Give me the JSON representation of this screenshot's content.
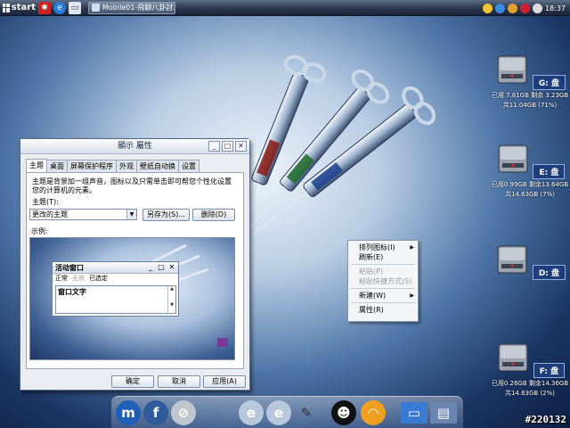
{
  "taskbar": {
    "start_label": "start",
    "task_button": "Mobile01-飛聊八卦討...",
    "clock": "18:37"
  },
  "dialog": {
    "title": "顯示 屬性",
    "tabs": [
      "主題",
      "桌面",
      "屏幕保护程序",
      "外观",
      "壁纸自动换",
      "设置"
    ],
    "description": "主题是背景加一组声音，图标以及只需单击即可帮您个性化设置您的计算机的元素。",
    "theme_label": "主题(T):",
    "theme_value": "更改的主题",
    "save_as_button": "另存为(S)...",
    "delete_button": "删除(D)",
    "sample_label": "示例:",
    "preview": {
      "window_title": "活动窗口",
      "menu_normal": "正常",
      "menu_disabled": "无效",
      "menu_selected": "已选定",
      "window_text": "窗口文字"
    },
    "ok_button": "确定",
    "cancel_button": "取消",
    "apply_button": "应用(A)"
  },
  "context_menu": {
    "groups": [
      [
        {
          "label": "排列图标(I)",
          "submenu": true
        },
        {
          "label": "刷新(E)",
          "submenu": false
        }
      ],
      [
        {
          "label": "粘贴(P)",
          "disabled": true
        },
        {
          "label": "粘贴快捷方式(S)",
          "disabled": true
        }
      ],
      [
        {
          "label": "新建(W)",
          "submenu": true
        }
      ],
      [
        {
          "label": "属性(R)",
          "submenu": false
        }
      ]
    ]
  },
  "drives": [
    {
      "letter": "G: 盘",
      "info1": "已用 7.81GB 剩余 3.23GB",
      "info2": "共11.04GB (71%)"
    },
    {
      "letter": "E: 盘",
      "info1": "已用0.99GB 剩余13.64GB",
      "info2": "共14.63GB (7%)"
    },
    {
      "letter": "D: 盘",
      "info1": "",
      "info2": ""
    },
    {
      "letter": "F: 盘",
      "info1": "已用0.26GB 剩余14.36GB",
      "info2": "共14.63GB (2%)"
    }
  ],
  "watermark": "#220132",
  "colors": {
    "accent": "#1e3d7a",
    "dialog_bg": "#e9edf2"
  }
}
